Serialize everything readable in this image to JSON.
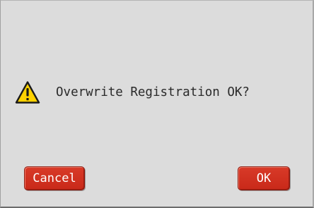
{
  "dialog": {
    "message": "Overwrite Registration OK?",
    "icon": "warning-icon",
    "cancel_label": "Cancel",
    "ok_label": "OK"
  },
  "colors": {
    "background": "#dcdcdc",
    "button": "#cf2f1f",
    "button_text": "#ffffff",
    "warning_fill": "#ffd200",
    "text": "#2a2a2a"
  }
}
